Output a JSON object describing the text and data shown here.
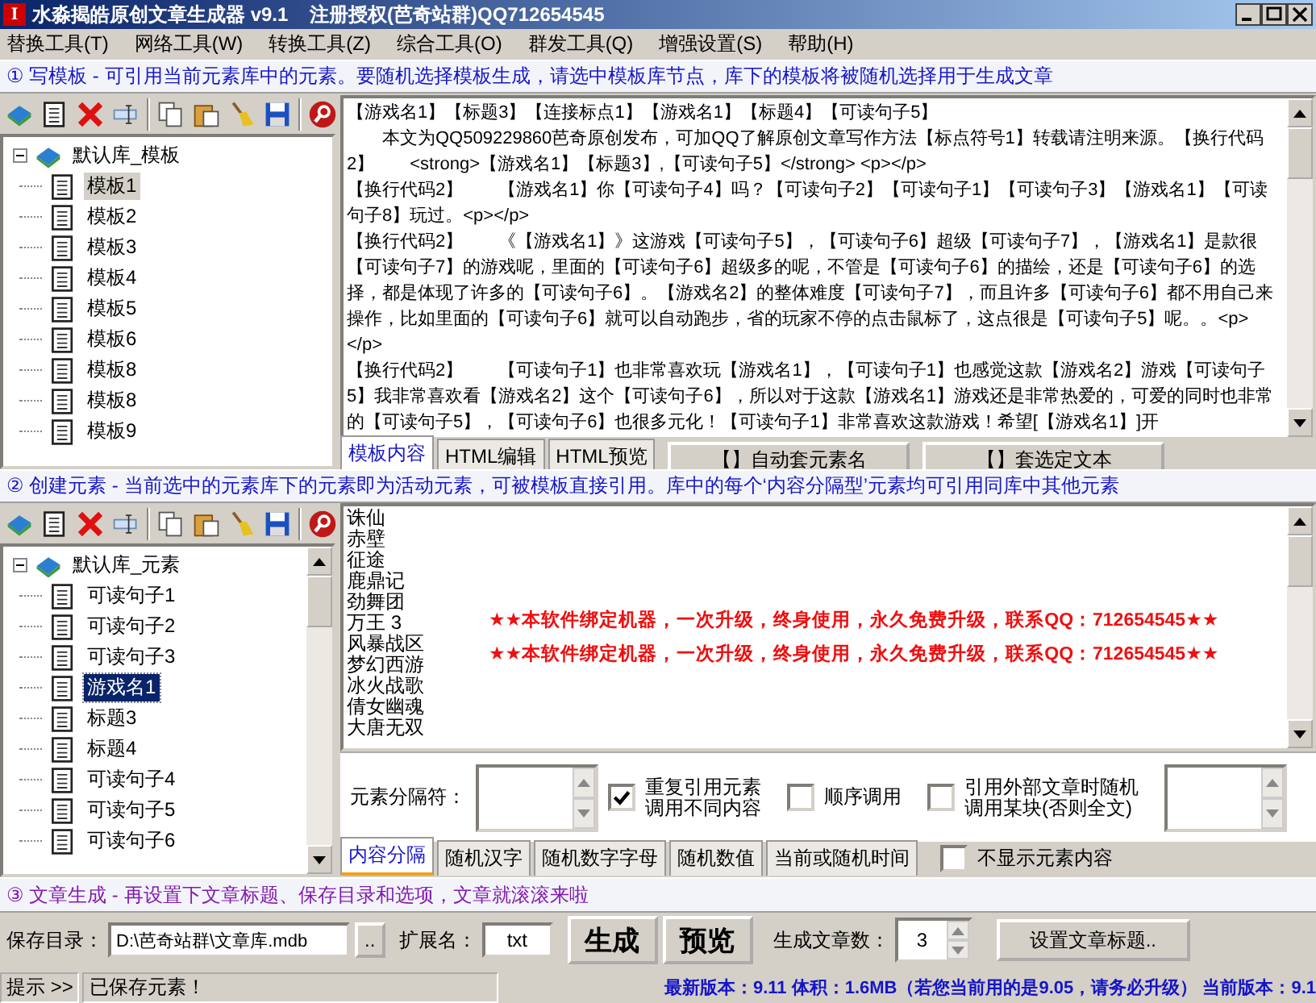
{
  "window": {
    "app_icon": "I",
    "title": "水淼揭皓原创文章生成器 v9.1    注册授权(芭奇站群)QQ712654545"
  },
  "menu": [
    "替换工具(T)",
    "网络工具(W)",
    "转换工具(Z)",
    "综合工具(O)",
    "群发工具(Q)",
    "增强设置(S)",
    "帮助(H)"
  ],
  "template_section": {
    "header": "① 写模板 - 可引用当前元素库中的元素。要随机选择模板生成，请选中模板库节点，库下的模板将被随机选择用于生成文章",
    "tree": {
      "focused": false,
      "root": {
        "label": "默认库_模板",
        "expanded": true,
        "children": [
          {
            "label": "模板1",
            "selected": true
          },
          {
            "label": "模板2",
            "selected": false
          },
          {
            "label": "模板3",
            "selected": false
          },
          {
            "label": "模板4",
            "selected": false
          },
          {
            "label": "模板5",
            "selected": false
          },
          {
            "label": "模板6",
            "selected": false
          },
          {
            "label": "模板8",
            "selected": false
          },
          {
            "label": "模板8",
            "selected": false
          },
          {
            "label": "模板9",
            "selected": false
          }
        ]
      }
    },
    "editor_paragraphs": [
      "【游戏名1】【标题3】【连接标点1】【游戏名1】【标题4】【可读句子5】",
      "　　本文为QQ509229860芭奇原创发布，可加QQ了解原创文章写作方法【标点符号1】转载请注明来源。【换行代码2】　　<strong>【游戏名1】【标题3】,【可读句子5】</strong> <p></p>",
      "【换行代码2】　　【游戏名1】你【可读句子4】吗？【可读句子2】【可读句子1】【可读句子3】【游戏名1】【可读句子8】玩过。<p></p>",
      "【换行代码2】　　《【游戏名1】》这游戏【可读句子5】，【可读句子6】超级【可读句子7】，【游戏名1】是款很【可读句子7】的游戏呢，里面的【可读句子6】超级多的呢，不管是【可读句子6】的描绘，还是【可读句子6】的选择，都是体现了许多的【可读句子6】。【游戏名2】的整体难度【可读句子7】，而且许多【可读句子6】都不用自己来操作，比如里面的【可读句子6】就可以自动跑步，省的玩家不停的点击鼠标了，这点很是【可读句子5】呢。。<p></p>",
      "【换行代码2】　　【可读句子1】也非常喜欢玩【游戏名1】，【可读句子1】也感觉这款【游戏名2】游戏【可读句子5】我非常喜欢看【游戏名2】这个【可读句子6】，所以对于这款【游戏名1】游戏还是非常热爱的，可爱的同时也非常的【可读句子5】，【可读句子6】也很多元化！【可读句子1】非常喜欢这款游戏！希望[【游戏名1】]开"
    ],
    "editor_tabs": [
      {
        "label": "模板内容",
        "selected": true
      },
      {
        "label": "HTML编辑",
        "selected": false
      },
      {
        "label": "HTML预览",
        "selected": false
      }
    ],
    "editor_buttons": [
      "【】自动套元素名",
      "【】套选定文本"
    ]
  },
  "element_section": {
    "header": "② 创建元素 - 当前选中的元素库下的元素即为活动元素，可被模板直接引用。库中的每个‘内容分隔型’元素均可引用同库中其他元素",
    "tree": {
      "focused": true,
      "root": {
        "label": "默认库_元素",
        "expanded": true,
        "children": [
          {
            "label": "可读句子1",
            "selected": false
          },
          {
            "label": "可读句子2",
            "selected": false
          },
          {
            "label": "可读句子3",
            "selected": false
          },
          {
            "label": "游戏名1",
            "selected": true
          },
          {
            "label": "标题3",
            "selected": false
          },
          {
            "label": "标题4",
            "selected": false
          },
          {
            "label": "可读句子4",
            "selected": false
          },
          {
            "label": "可读句子5",
            "selected": false
          },
          {
            "label": "可读句子6",
            "selected": false
          }
        ]
      }
    },
    "content_lines": [
      "诛仙",
      "赤壁",
      "征途",
      "鹿鼎记",
      "劲舞团",
      "万王 3",
      "风暴战区",
      "梦幻西游",
      "冰火战歌",
      "倩女幽魂",
      "大唐无双"
    ],
    "notices": [
      "★★本软件绑定机器，一次升级，终身使用，永久免费升级，联系QQ：712654545★★",
      "★★本软件绑定机器，一次升级，终身使用，永久免费升级，联系QQ：712654545★★"
    ],
    "separator_label": "元素分隔符：",
    "options": [
      {
        "label_lines": [
          "重复引用元素",
          "调用不同内容"
        ],
        "checked": true
      },
      {
        "label_lines": [
          "顺序调用"
        ],
        "checked": false
      },
      {
        "label_lines": [
          "引用外部文章时随机",
          "调用某块(否则全文)"
        ],
        "checked": false
      }
    ],
    "tabs": [
      {
        "label": "内容分隔",
        "selected": true
      },
      {
        "label": "随机汉字",
        "selected": false
      },
      {
        "label": "随机数字字母",
        "selected": false
      },
      {
        "label": "随机数值",
        "selected": false
      },
      {
        "label": "当前或随机时间",
        "selected": false
      }
    ],
    "hide_content": {
      "label": "不显示元素内容",
      "checked": false
    }
  },
  "generate_section": {
    "header": "③ 文章生成 - 再设置下文章标题、保存目录和选项，文章就滚滚来啦",
    "save_dir_label": "保存目录：",
    "save_dir": "D:\\芭奇站群\\文章库.mdb",
    "browse_button": "..",
    "ext_label": "扩展名：",
    "ext": "txt",
    "generate_button": "生成",
    "preview_button": "预览",
    "count_label": "生成文章数：",
    "count": "3",
    "title_button": "设置文章标题.."
  },
  "status_bar": {
    "prompt": "提示 >>",
    "message": "已保存元素！",
    "version_info": "最新版本：9.11 体积：1.6MB（若您当前用的是9.05，请务必升级） 当前版本：9.1"
  }
}
